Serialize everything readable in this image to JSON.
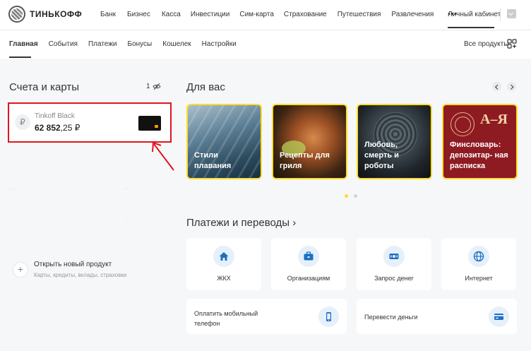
{
  "brand": {
    "name": "ТИНЬКОФФ"
  },
  "top_nav": {
    "items": [
      "Банк",
      "Бизнес",
      "Касса",
      "Инвестиции",
      "Сим-карта",
      "Страхование",
      "Путешествия",
      "Развлечения"
    ],
    "more": "•••",
    "cabinet": "Личный кабинет"
  },
  "sub_nav": {
    "tabs": [
      "Главная",
      "События",
      "Платежи",
      "Бонусы",
      "Кошелек",
      "Настройки"
    ],
    "active_index": 0,
    "all_products": "Все продукты"
  },
  "accounts": {
    "title": "Счета и карты",
    "count": "1",
    "items": [
      {
        "currency_symbol": "₽",
        "name": "Tinkoff Black",
        "balance_int": "62 852",
        "balance_frac": ",25 ₽"
      }
    ],
    "new_product": {
      "plus": "+",
      "title": "Открыть новый продукт",
      "subtitle": "Карты, кредиты, вклады, страховки"
    }
  },
  "for_you": {
    "title": "Для вас",
    "stories": [
      {
        "label": "Стили плавания"
      },
      {
        "label": "Рецепты для гриля"
      },
      {
        "label": "Любовь, смерть и роботы"
      },
      {
        "label": "Финсловарь: депозитар- ная расписка",
        "badge": "А–Я"
      }
    ],
    "active_dot": 0
  },
  "payments": {
    "title": "Платежи и переводы ›",
    "tiles": [
      {
        "label": "ЖКХ",
        "icon": "house-icon"
      },
      {
        "label": "Организациям",
        "icon": "briefcase-icon"
      },
      {
        "label": "Запрос денег",
        "icon": "money-request-icon"
      },
      {
        "label": "Интернет",
        "icon": "globe-icon"
      }
    ],
    "wide_tiles": [
      {
        "label": "Оплатить мобильный телефон",
        "icon": "phone-icon"
      },
      {
        "label": "Перевести деньги",
        "icon": "card-icon"
      }
    ]
  },
  "colors": {
    "accent_yellow": "#ffdd2d",
    "highlight_red": "#e0161f",
    "icon_blue": "#1d6fc4"
  }
}
